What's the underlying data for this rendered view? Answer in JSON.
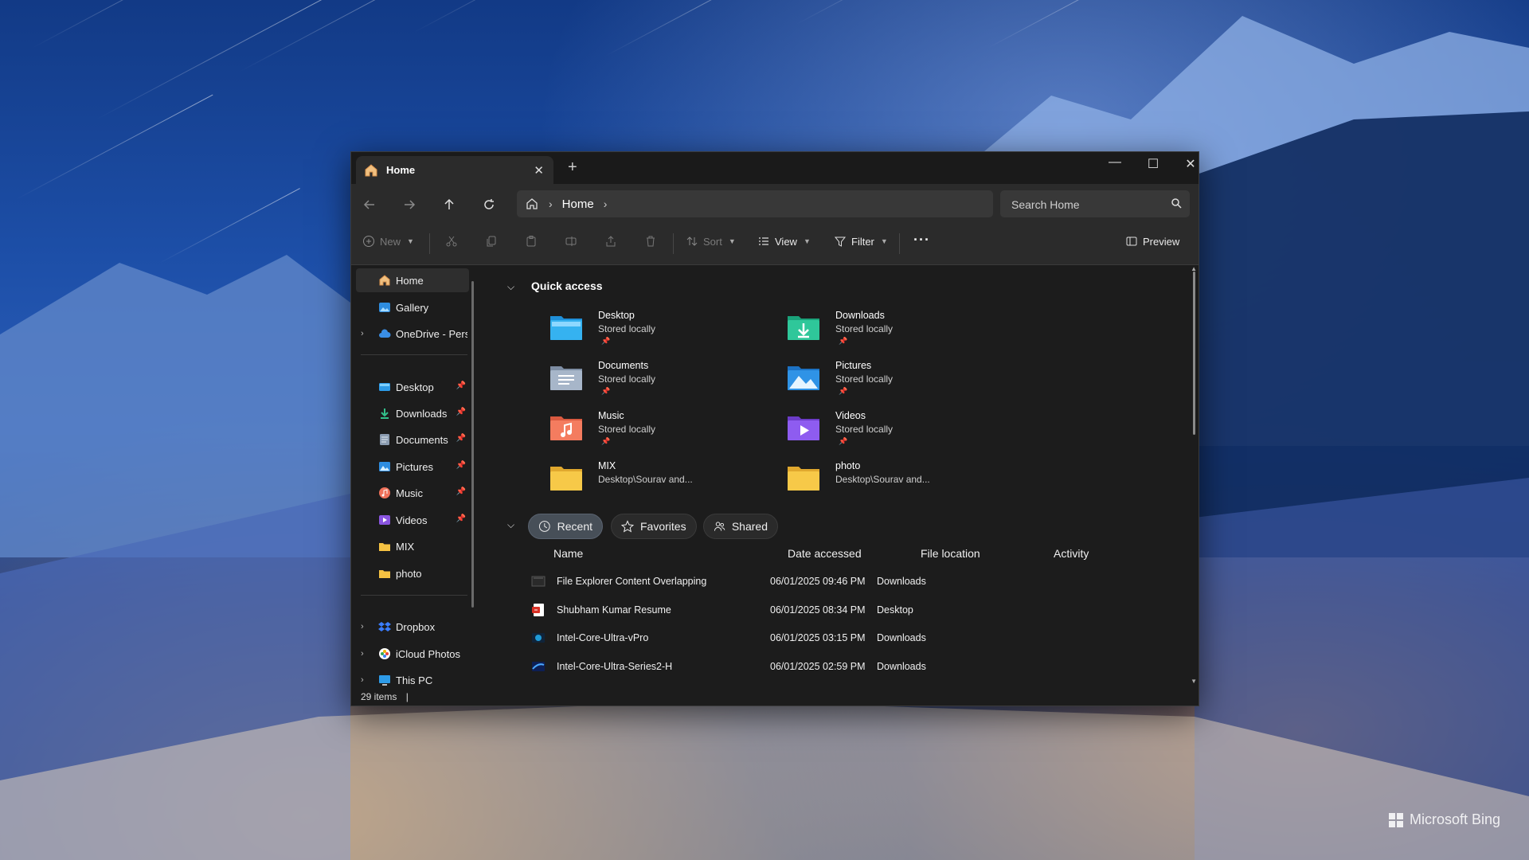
{
  "window": {
    "tab_title": "Home",
    "tab_close": "✕",
    "new_tab": "+",
    "minimize": "—",
    "maximize": "☐",
    "close": "✕"
  },
  "nav": {
    "breadcrumb": [
      "Home"
    ],
    "search_placeholder": "Search Home"
  },
  "commands": {
    "new": "New",
    "sort": "Sort",
    "view": "View",
    "filter": "Filter",
    "more": "···",
    "preview": "Preview"
  },
  "sidebar": {
    "items": [
      {
        "label": "Home",
        "icon": "home-icon",
        "selected": true
      },
      {
        "label": "Gallery",
        "icon": "gallery-icon"
      },
      {
        "label": "OneDrive - Pers",
        "icon": "cloud-icon",
        "expandable": true
      }
    ],
    "pinned": [
      {
        "label": "Desktop",
        "icon": "desktop-icon"
      },
      {
        "label": "Downloads",
        "icon": "downloads-icon"
      },
      {
        "label": "Documents",
        "icon": "documents-icon"
      },
      {
        "label": "Pictures",
        "icon": "pictures-icon"
      },
      {
        "label": "Music",
        "icon": "music-icon"
      },
      {
        "label": "Videos",
        "icon": "videos-icon"
      },
      {
        "label": "MIX",
        "icon": "folder-icon"
      },
      {
        "label": "photo",
        "icon": "folder-icon"
      }
    ],
    "locations": [
      {
        "label": "Dropbox",
        "icon": "dropbox-icon"
      },
      {
        "label": "iCloud Photos",
        "icon": "icloud-icon"
      },
      {
        "label": "This PC",
        "icon": "pc-icon"
      }
    ]
  },
  "quick_access": {
    "title": "Quick access",
    "items": [
      {
        "name": "Desktop",
        "sub": "Stored locally",
        "icon": "desktop-folder-icon"
      },
      {
        "name": "Downloads",
        "sub": "Stored locally",
        "icon": "downloads-folder-icon"
      },
      {
        "name": "Documents",
        "sub": "Stored locally",
        "icon": "documents-folder-icon"
      },
      {
        "name": "Pictures",
        "sub": "Stored locally",
        "icon": "pictures-folder-icon"
      },
      {
        "name": "Music",
        "sub": "Stored locally",
        "icon": "music-folder-icon"
      },
      {
        "name": "Videos",
        "sub": "Stored locally",
        "icon": "videos-folder-icon"
      },
      {
        "name": "MIX",
        "sub": "Desktop\\Sourav and...",
        "icon": "folder-icon"
      },
      {
        "name": "photo",
        "sub": "Desktop\\Sourav and...",
        "icon": "folder-icon"
      }
    ]
  },
  "recent": {
    "filters": [
      {
        "label": "Recent",
        "active": true,
        "icon": "clock-icon"
      },
      {
        "label": "Favorites",
        "icon": "star-icon"
      },
      {
        "label": "Shared",
        "icon": "people-icon"
      }
    ],
    "columns": [
      "Name",
      "Date accessed",
      "File location",
      "Activity"
    ],
    "rows": [
      {
        "name": "File Explorer Content Overlapping",
        "date": "06/01/2025 09:46 PM",
        "location": "Downloads",
        "icon": "image-file-icon"
      },
      {
        "name": "Shubham Kumar Resume",
        "date": "06/01/2025 08:34 PM",
        "location": "Desktop",
        "icon": "pdf-file-icon"
      },
      {
        "name": "Intel-Core-Ultra-vPro",
        "date": "06/01/2025 03:15 PM",
        "location": "Downloads",
        "icon": "image-file-icon"
      },
      {
        "name": "Intel-Core-Ultra-Series2-H",
        "date": "06/01/2025 02:59 PM",
        "location": "Downloads",
        "icon": "image-file-icon"
      }
    ]
  },
  "status": {
    "items_count": "29 items",
    "divider": "|"
  },
  "wallpaper": {
    "watermark": "Microsoft Bing"
  }
}
